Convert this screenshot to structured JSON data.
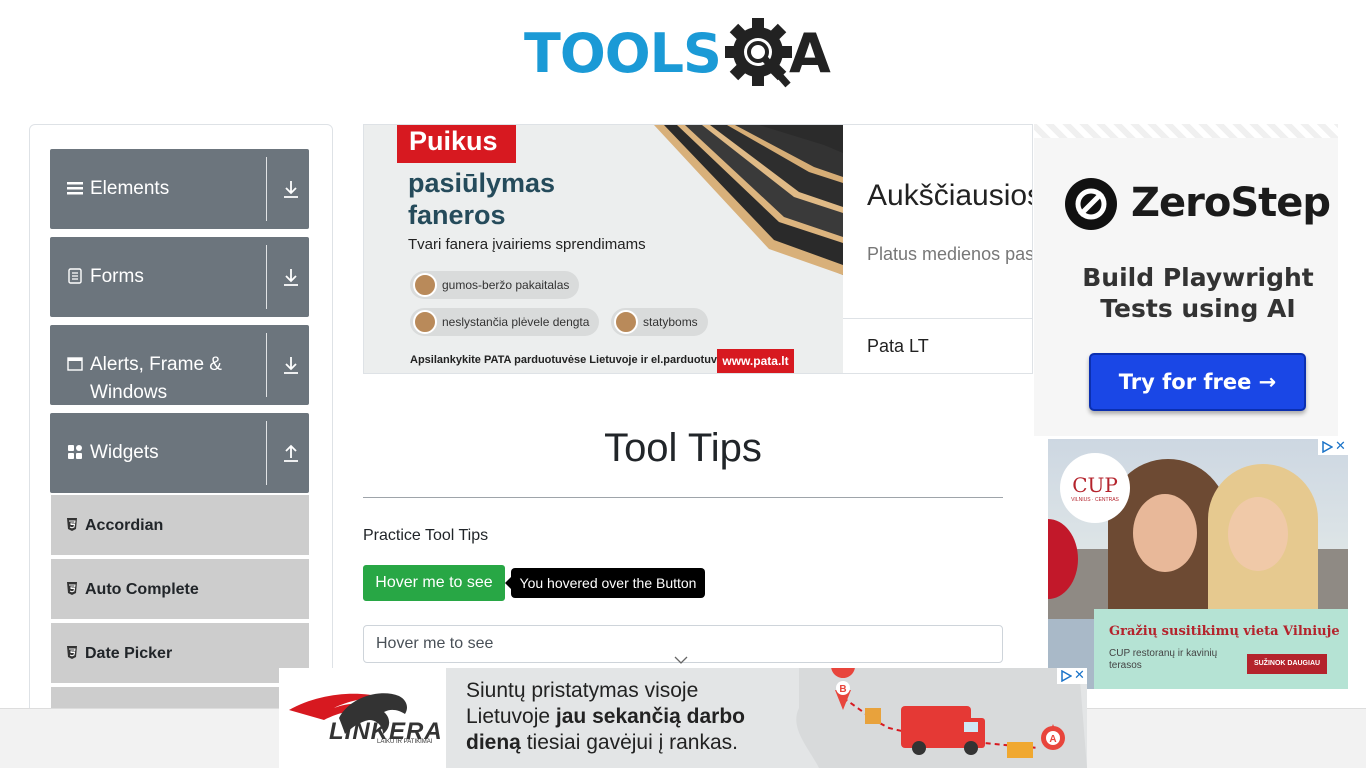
{
  "header": {
    "logo_text": "TOOLS",
    "logo_suffix": "A"
  },
  "sidebar": {
    "groups": [
      {
        "label": "Elements",
        "icon": "hamburger-icon",
        "arrow": "download-icon"
      },
      {
        "label": "Forms",
        "icon": "form-doc-icon",
        "arrow": "download-icon"
      },
      {
        "label": "Alerts, Frame & Windows",
        "icon": "window-icon",
        "arrow": "download-icon"
      },
      {
        "label": "Widgets",
        "icon": "widgets-grid-icon",
        "arrow": "upload-icon"
      }
    ],
    "widget_items": [
      {
        "label": "Accordian",
        "icon": "html5-icon"
      },
      {
        "label": "Auto Complete",
        "icon": "html5-icon"
      },
      {
        "label": "Date Picker",
        "icon": "html5-icon"
      }
    ]
  },
  "center_ad": {
    "badge": "Puikus",
    "title_line1": "pasiūlymas",
    "title_line2": "faneros",
    "subtitle": "Tvari fanera įvairiems sprendimams",
    "chips": [
      "gumos-beržo pakaitalas",
      "neslystančia plėvele dengta",
      "statyboms"
    ],
    "footer": "Apsilankykite PATA parduotuvėse Lietuvoje ir el.parduotuvėje:",
    "url": "www.pata.lt",
    "right_title": "Aukščiausios",
    "right_desc": "Platus medienos pas",
    "right_brand": "Pata LT"
  },
  "main": {
    "title": "Tool Tips",
    "practice_label": "Practice Tool Tips",
    "button_label": "Hover me to see",
    "tooltip_text": "You hovered over the Button",
    "input_placeholder": "Hover me to see"
  },
  "zerostep_ad": {
    "brand": "ZeroStep",
    "tagline_line1": "Build Playwright",
    "tagline_line2": "Tests using AI",
    "cta": "Try for free →"
  },
  "cup_ad": {
    "logo": "CUP",
    "logo_sub": "VILNIUS · CENTRAS",
    "headline": "Gražių susitikimų vieta Vilniuje",
    "desc": "CUP restoranų ir kavinių terasos",
    "cta": "SUŽINOK DAUGIAU"
  },
  "linkera_ad": {
    "brand": "LINKERA",
    "slogan": "LAIKU IR PATIKIMAI",
    "text_part1": "Siuntų pristatymas visoje Lietuvoje ",
    "text_bold1": "jau sekančią darbo dieną",
    "text_part2": " tiesiai gavėjui į rankas.",
    "marker_a": "A",
    "marker_b": "B"
  },
  "colors": {
    "sidebar_header": "#6c757d",
    "sidebar_item": "#cdcdcd",
    "button_green": "#28a745",
    "logo_blue": "#1b9ad6",
    "zerostep_button": "#1a47e6",
    "pata_red": "#d71920"
  }
}
